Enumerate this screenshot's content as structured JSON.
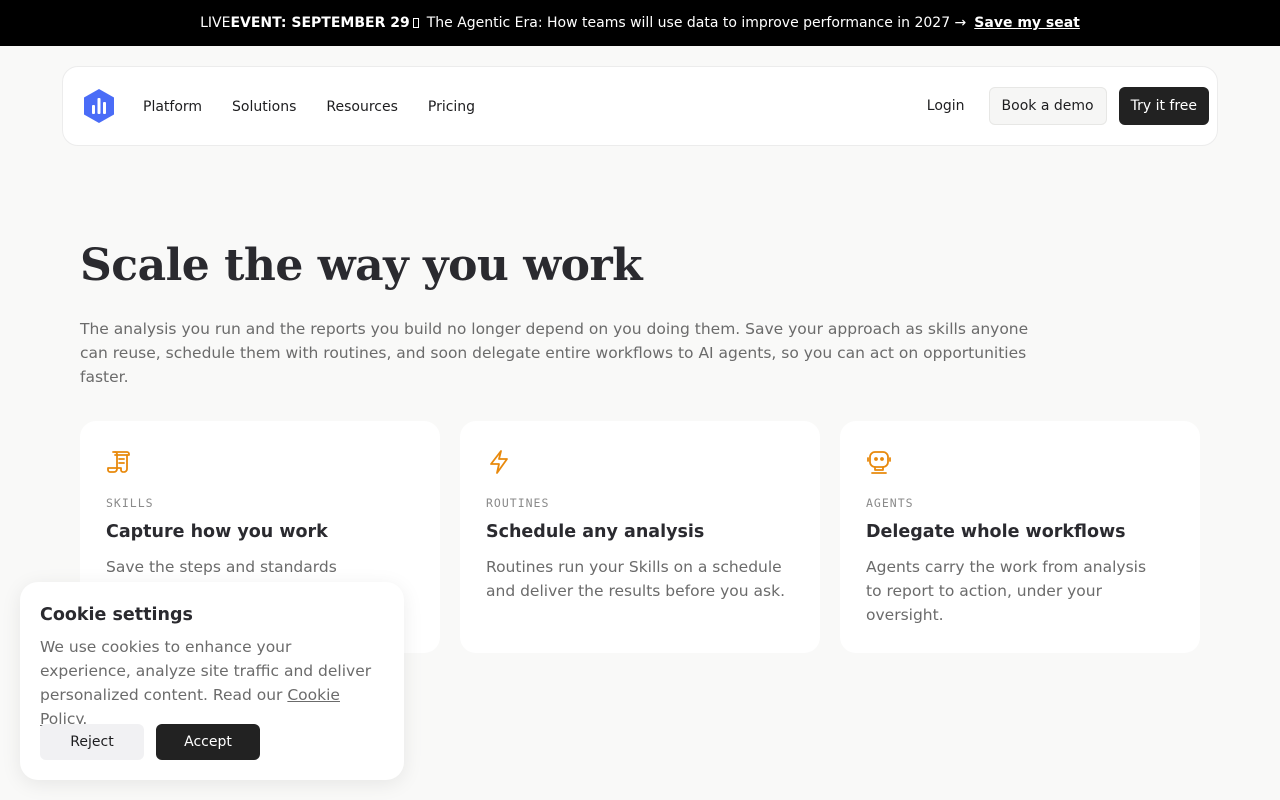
{
  "banner": {
    "prefix": "LIVE ",
    "event": "EVENT: SEPTEMBER 29",
    "headline": "The Agentic Era: How teams will use data to improve performance in 2027 →",
    "cta": "Save my seat"
  },
  "nav": {
    "logo_icon": "bar-chart-hexagon-icon",
    "links": [
      "Platform",
      "Solutions",
      "Resources",
      "Pricing"
    ],
    "login": "Login",
    "book_demo": "Book a demo",
    "try_free": "Try it free"
  },
  "hero": {
    "title": "Scale the way you work",
    "subtitle": "The analysis you run and the reports you build no longer depend on you doing them. Save your approach as skills anyone can reuse, schedule them with routines, and soon delegate entire workflows to AI agents, so you can act on opportunities faster."
  },
  "cards": [
    {
      "icon": "scroll-icon",
      "kicker": "SKILLS",
      "title": "Capture how you work",
      "desc": "Save the steps and standards"
    },
    {
      "icon": "lightning-icon",
      "kicker": "ROUTINES",
      "title": "Schedule any analysis",
      "desc": "Routines run your Skills on a schedule and deliver the results before you ask."
    },
    {
      "icon": "robot-icon",
      "kicker": "AGENTS",
      "title": "Delegate whole workflows",
      "desc": "Agents carry the work from analysis to report to action, under your oversight."
    }
  ],
  "cookie": {
    "title": "Cookie settings",
    "body": "We use cookies to enhance your experience, analyze site traffic and deliver personalized content. Read our ",
    "link": "Cookie Policy",
    "period": ".",
    "reject": "Reject",
    "accept": "Accept"
  },
  "colors": {
    "accent_icon": "#e8890c",
    "logo_blue": "#4a6cf7",
    "primary_button": "#222222",
    "banner_bg": "#000000"
  }
}
